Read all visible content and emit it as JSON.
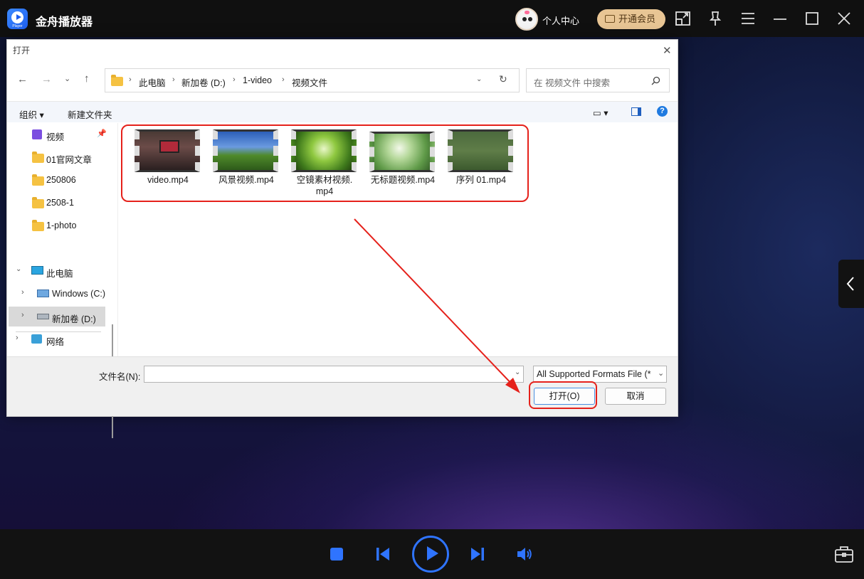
{
  "app": {
    "title": "金舟播放器",
    "logo_caption": "Player",
    "user_center": "个人中心",
    "vip_button": "开通会员"
  },
  "dialog": {
    "title": "打开",
    "breadcrumb": [
      "此电脑",
      "新加卷 (D:)",
      "1-video",
      "视频文件"
    ],
    "search_placeholder": "在 视频文件 中搜索",
    "toolbar": {
      "organize": "组织",
      "new_folder": "新建文件夹"
    },
    "nav_items": [
      {
        "label": "视频",
        "icon": "video-library-icon",
        "pinned": true
      },
      {
        "label": "01官网文章",
        "icon": "folder-icon"
      },
      {
        "label": "250806",
        "icon": "folder-icon"
      },
      {
        "label": "2508-1",
        "icon": "folder-icon"
      },
      {
        "label": "1-photo",
        "icon": "folder-icon"
      },
      {
        "label": "此电脑",
        "icon": "computer-icon"
      },
      {
        "label": "Windows (C:)",
        "icon": "drive-c-icon"
      },
      {
        "label": "新加卷 (D:)",
        "icon": "drive-d-icon",
        "selected": true
      },
      {
        "label": "网络",
        "icon": "network-icon"
      }
    ],
    "files": [
      {
        "name": "video.mp4"
      },
      {
        "name": "风景视频.mp4"
      },
      {
        "name_line1": "空镜素材视频.",
        "name_line2": "mp4"
      },
      {
        "name": "无标题视频.mp4"
      },
      {
        "name": "序列 01.mp4"
      }
    ],
    "file_name_label": "文件名(N):",
    "file_name_value": "",
    "file_type": "All Supported Formats File (*",
    "open_button": "打开(O)",
    "cancel_button": "取消"
  },
  "colors": {
    "accent": "#2f74ff",
    "annotation": "#e5211b",
    "vip": "#e8c594"
  }
}
